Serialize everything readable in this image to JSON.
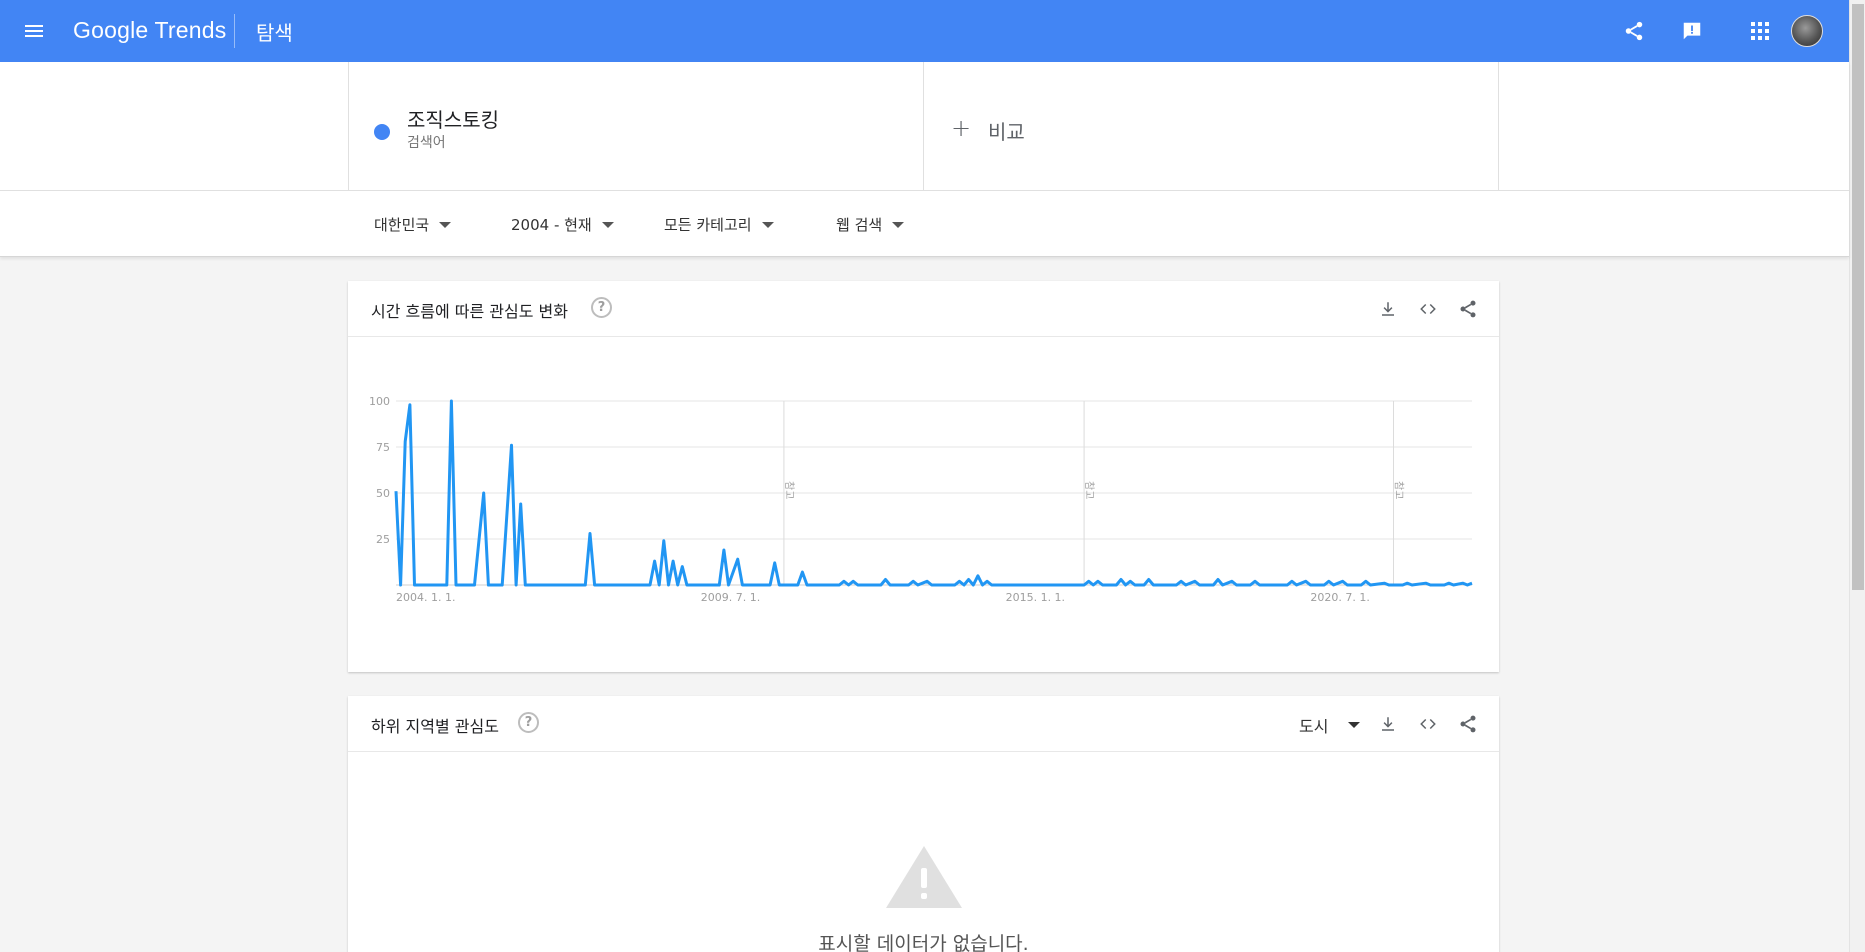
{
  "topbar": {
    "logo": "Google Trends",
    "page": "탐색",
    "icons": [
      "menu-icon",
      "share-icon",
      "feedback-icon",
      "apps-icon",
      "account-avatar"
    ],
    "color": "#4285f4"
  },
  "search": {
    "term": "조직스토킹",
    "term_type": "검색어",
    "term_color": "#4285f4",
    "compare_label": "비교"
  },
  "filters": {
    "region": "대한민국",
    "period": "2004 - 현재",
    "category": "모든 카테고리",
    "search_type": "웹 검색"
  },
  "interest_over_time": {
    "title": "시간 흐름에 따른 관심도 변화",
    "note_label": "참고"
  },
  "subregion": {
    "title": "하위 지역별 관심도",
    "resolution": "도시",
    "no_data": "표시할 데이터가 없습니다."
  },
  "chart_data": {
    "type": "line",
    "x_ticks": [
      "2004. 1. 1.",
      "2009. 7. 1.",
      "2015. 1. 1.",
      "2020. 7. 1."
    ],
    "y_ticks": [
      100,
      75,
      50,
      25
    ],
    "ylim": [
      0,
      100
    ],
    "xlim": [
      "2004-01",
      "2023-06"
    ],
    "series": [
      {
        "name": "조직스토킹",
        "color": "#4285f4",
        "points": [
          [
            "2004-01",
            51
          ],
          [
            "2004-02",
            0
          ],
          [
            "2004-03",
            78
          ],
          [
            "2004-04",
            98
          ],
          [
            "2004-05",
            0
          ],
          [
            "2004-12",
            0
          ],
          [
            "2005-01",
            100
          ],
          [
            "2005-02",
            0
          ],
          [
            "2005-06",
            0
          ],
          [
            "2005-08",
            50
          ],
          [
            "2005-09",
            0
          ],
          [
            "2005-12",
            0
          ],
          [
            "2006-02",
            76
          ],
          [
            "2006-03",
            0
          ],
          [
            "2006-04",
            44
          ],
          [
            "2006-05",
            0
          ],
          [
            "2007-06",
            0
          ],
          [
            "2007-07",
            28
          ],
          [
            "2007-08",
            0
          ],
          [
            "2008-08",
            0
          ],
          [
            "2008-09",
            13
          ],
          [
            "2008-10",
            0
          ],
          [
            "2008-11",
            24
          ],
          [
            "2008-12",
            0
          ],
          [
            "2009-01",
            13
          ],
          [
            "2009-02",
            0
          ],
          [
            "2009-03",
            10
          ],
          [
            "2009-04",
            0
          ],
          [
            "2009-11",
            0
          ],
          [
            "2009-12",
            19
          ],
          [
            "2010-01",
            0
          ],
          [
            "2010-03",
            14
          ],
          [
            "2010-04",
            0
          ],
          [
            "2010-10",
            0
          ],
          [
            "2010-11",
            12
          ],
          [
            "2010-12",
            0
          ],
          [
            "2011-04",
            0
          ],
          [
            "2011-05",
            7
          ],
          [
            "2011-06",
            0
          ],
          [
            "2012-01",
            0
          ],
          [
            "2012-02",
            2
          ],
          [
            "2012-03",
            0
          ],
          [
            "2012-04",
            2
          ],
          [
            "2012-05",
            0
          ],
          [
            "2012-10",
            0
          ],
          [
            "2012-11",
            3
          ],
          [
            "2012-12",
            0
          ],
          [
            "2013-04",
            0
          ],
          [
            "2013-05",
            2
          ],
          [
            "2013-06",
            0
          ],
          [
            "2013-08",
            2
          ],
          [
            "2013-09",
            0
          ],
          [
            "2014-02",
            0
          ],
          [
            "2014-03",
            2
          ],
          [
            "2014-04",
            0
          ],
          [
            "2014-05",
            3
          ],
          [
            "2014-06",
            0
          ],
          [
            "2014-07",
            5
          ],
          [
            "2014-08",
            0
          ],
          [
            "2014-09",
            2
          ],
          [
            "2014-10",
            0
          ],
          [
            "2016-06",
            0
          ],
          [
            "2016-07",
            2
          ],
          [
            "2016-08",
            0
          ],
          [
            "2016-09",
            2
          ],
          [
            "2016-10",
            0
          ],
          [
            "2017-01",
            0
          ],
          [
            "2017-02",
            3
          ],
          [
            "2017-03",
            0
          ],
          [
            "2017-04",
            2
          ],
          [
            "2017-05",
            0
          ],
          [
            "2017-07",
            0
          ],
          [
            "2017-08",
            3
          ],
          [
            "2017-09",
            0
          ],
          [
            "2018-02",
            0
          ],
          [
            "2018-03",
            2
          ],
          [
            "2018-04",
            0
          ],
          [
            "2018-06",
            2
          ],
          [
            "2018-07",
            0
          ],
          [
            "2018-10",
            0
          ],
          [
            "2018-11",
            3
          ],
          [
            "2018-12",
            0
          ],
          [
            "2019-02",
            2
          ],
          [
            "2019-03",
            0
          ],
          [
            "2019-06",
            0
          ],
          [
            "2019-07",
            2
          ],
          [
            "2019-08",
            0
          ],
          [
            "2020-02",
            0
          ],
          [
            "2020-03",
            2
          ],
          [
            "2020-04",
            0
          ],
          [
            "2020-06",
            2
          ],
          [
            "2020-07",
            0
          ],
          [
            "2020-10",
            0
          ],
          [
            "2020-11",
            2
          ],
          [
            "2020-12",
            0
          ],
          [
            "2021-02",
            2
          ],
          [
            "2021-03",
            0
          ],
          [
            "2021-06",
            0
          ],
          [
            "2021-07",
            2
          ],
          [
            "2021-08",
            0
          ],
          [
            "2021-11",
            1
          ],
          [
            "2021-12",
            0
          ],
          [
            "2022-03",
            0
          ],
          [
            "2022-04",
            1
          ],
          [
            "2022-05",
            0
          ],
          [
            "2022-08",
            1
          ],
          [
            "2022-09",
            0
          ],
          [
            "2022-12",
            0
          ],
          [
            "2023-01",
            1
          ],
          [
            "2023-02",
            0
          ],
          [
            "2023-04",
            1
          ],
          [
            "2023-05",
            0
          ],
          [
            "2023-06",
            1
          ]
        ]
      }
    ],
    "annotations": [
      {
        "x": "2011-01",
        "label": "참고"
      },
      {
        "x": "2016-06",
        "label": "참고"
      },
      {
        "x": "2022-01",
        "label": "참고"
      }
    ],
    "grid": true,
    "legend": "none"
  }
}
